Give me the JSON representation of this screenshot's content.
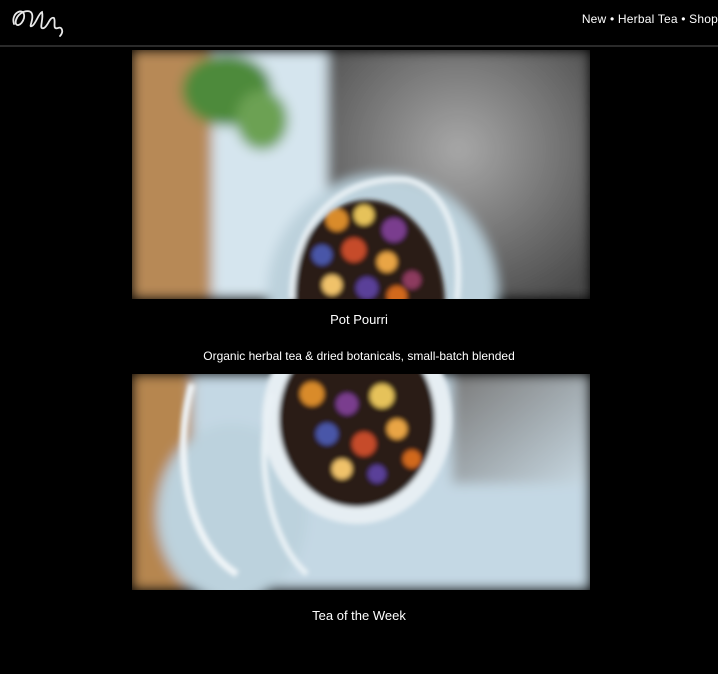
{
  "brand": {
    "logo_text": "Oh Tea"
  },
  "nav": {
    "links_text": "New • Herbal Tea • Shop"
  },
  "photos": [
    {
      "icon": "tea-jar-top-view-photo",
      "caption": "Pot Pourri"
    },
    {
      "icon": "tea-jar-side-view-photo",
      "caption": "Tea of the Week"
    }
  ],
  "tagline": "Organic herbal tea & dried botanicals, small-batch blended",
  "colors": {
    "background": "#000000",
    "text": "#ffffff",
    "jar_blue": "#cfe0ea"
  }
}
